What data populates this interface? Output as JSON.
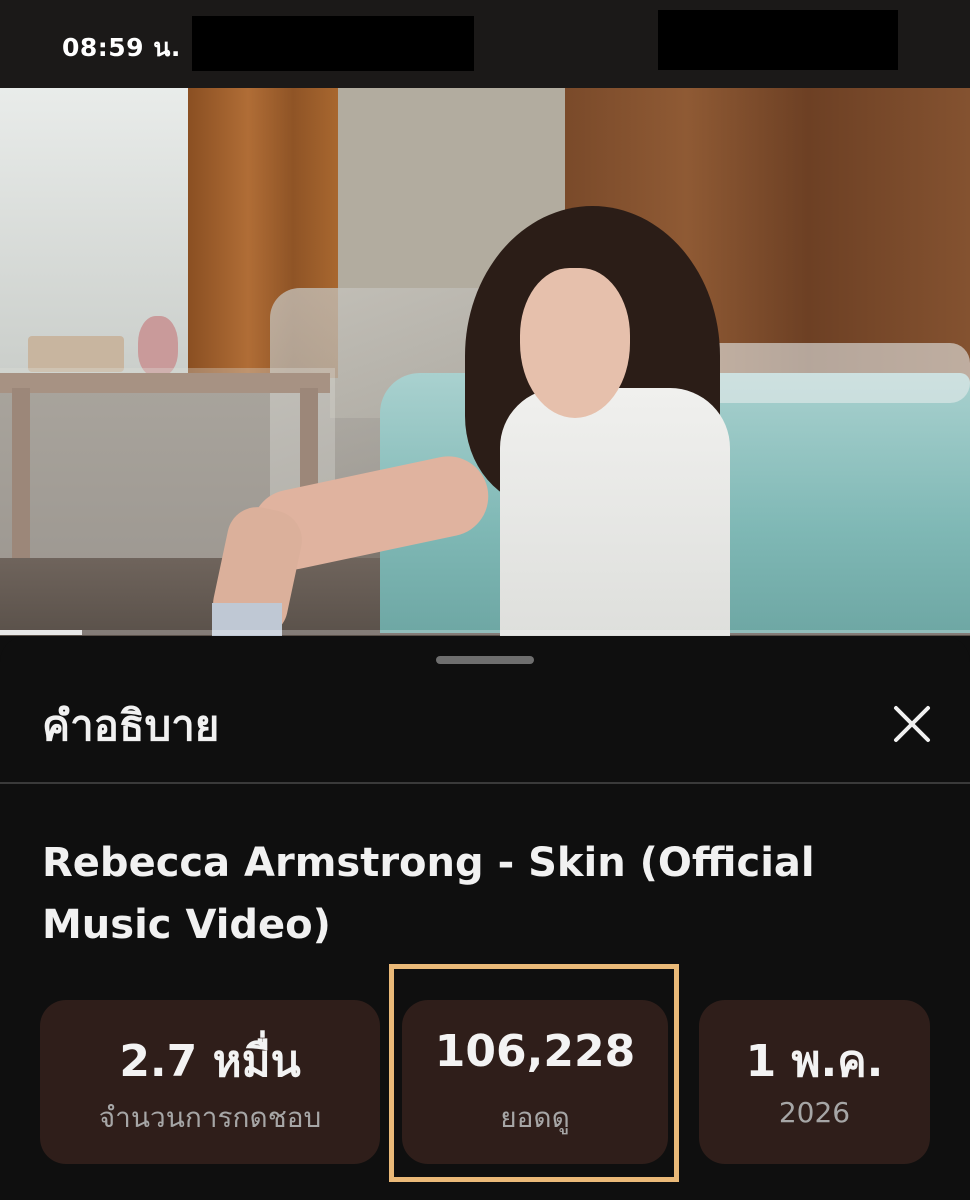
{
  "status_bar": {
    "time": "08:59 น."
  },
  "video": {
    "progress_fraction": 0.085
  },
  "sheet": {
    "title": "คำอธิบาย",
    "video_title": "Rebecca Armstrong - Skin (Official Music Video)",
    "stats": [
      {
        "value": "2.7 หมื่น",
        "label": "จำนวนการกดชอบ"
      },
      {
        "value": "106,228",
        "label": "ยอดดู"
      },
      {
        "value": "1 พ.ค.",
        "label": "2026"
      }
    ]
  },
  "icons": {
    "close": "close-icon"
  },
  "colors": {
    "highlight": "#eab978",
    "card_bg": "#2f1e1a",
    "sheet_bg": "#0f0f0f"
  }
}
